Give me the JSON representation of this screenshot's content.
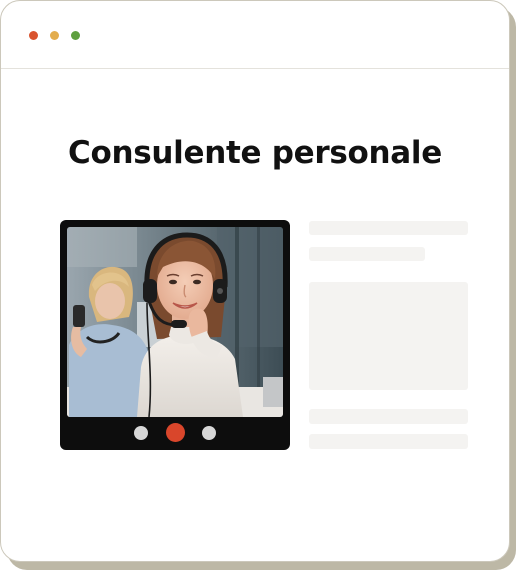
{
  "window": {
    "controls": [
      "close",
      "minimize",
      "maximize"
    ],
    "colors": {
      "close": "#d9542f",
      "minimize": "#e3ad4d",
      "maximize": "#5fa040"
    }
  },
  "page": {
    "title": "Consulente personale"
  },
  "video_call": {
    "subject": "smiling woman wearing headset at call center, colleague on phone in background",
    "controls": [
      {
        "name": "left-control",
        "color": "#d7d7d7"
      },
      {
        "name": "end-call",
        "color": "#d9462b"
      },
      {
        "name": "right-control",
        "color": "#d7d7d7"
      }
    ]
  },
  "content_placeholders": {
    "count": 5,
    "color": "#f4f3f1"
  }
}
